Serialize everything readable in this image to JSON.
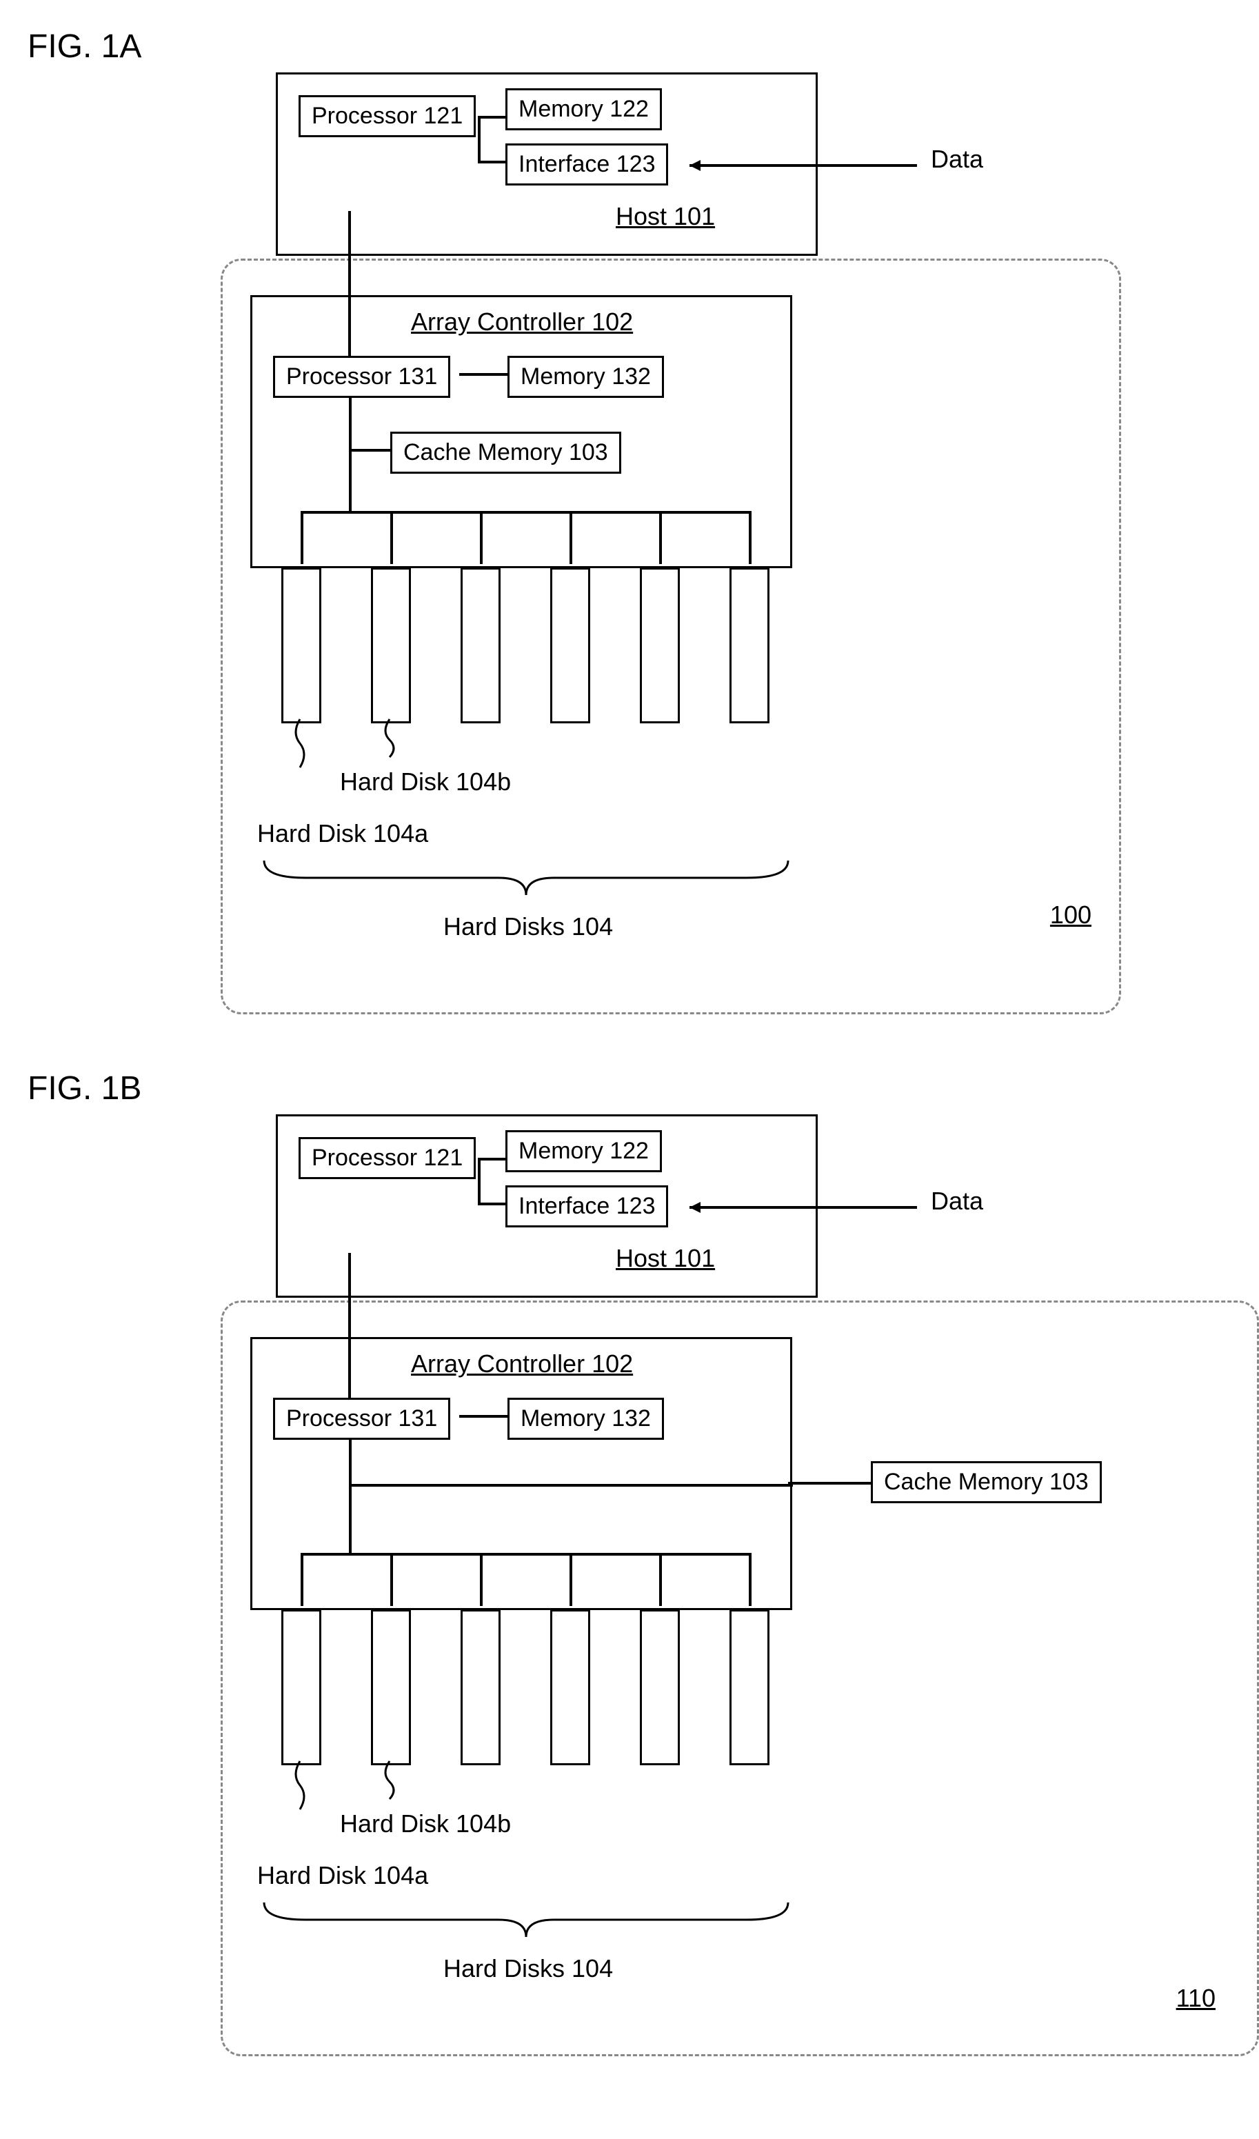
{
  "fig_a": {
    "label": "FIG. 1A",
    "host": {
      "processor": "Processor 121",
      "memory": "Memory 122",
      "interface": "Interface 123",
      "host_label": "Host 101",
      "data_label": "Data"
    },
    "array": {
      "title": "Array Controller 102",
      "processor": "Processor 131",
      "memory": "Memory 132",
      "cache": "Cache Memory 103"
    },
    "disks": {
      "disk_a": "Hard Disk 104a",
      "disk_b": "Hard Disk 104b",
      "group": "Hard Disks 104"
    },
    "ref": "100"
  },
  "fig_b": {
    "label": "FIG. 1B",
    "host": {
      "processor": "Processor 121",
      "memory": "Memory 122",
      "interface": "Interface 123",
      "host_label": "Host 101",
      "data_label": "Data"
    },
    "array": {
      "title": "Array Controller 102",
      "processor": "Processor 131",
      "memory": "Memory 132",
      "cache": "Cache Memory 103"
    },
    "disks": {
      "disk_a": "Hard Disk 104a",
      "disk_b": "Hard Disk 104b",
      "group": "Hard Disks 104"
    },
    "ref": "110"
  }
}
